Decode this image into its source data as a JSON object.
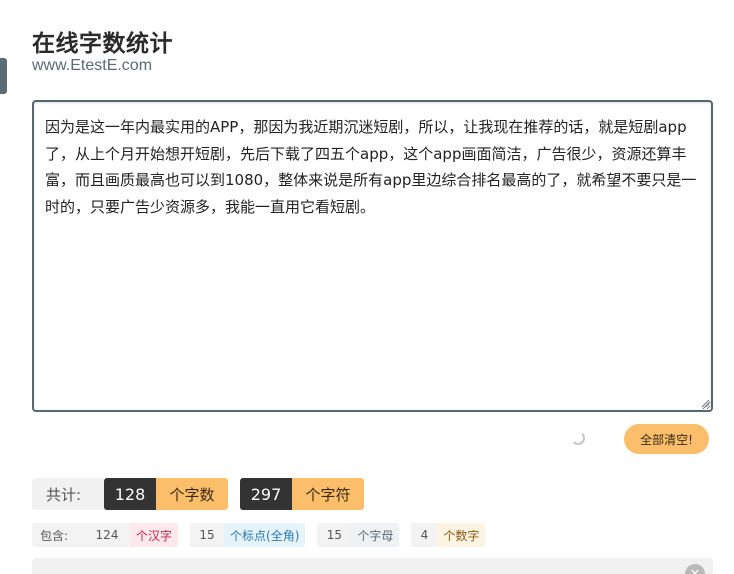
{
  "header": {
    "title": "在线字数统计",
    "site": "www.EtestE.com"
  },
  "editor": {
    "text": "因为是这一年内最实用的APP，那因为我近期沉迷短剧，所以，让我现在推荐的话，就是短剧app了，从上个月开始想开短剧，先后下载了四五个app，这个app画面简洁，广告很少，资源还算丰富，而且画质最高也可以到1080，整体来说是所有app里边综合排名最高的了，就希望不要只是一时的，只要广告少资源多，我能一直用它看短剧。"
  },
  "actions": {
    "clear_label": "全部清空!"
  },
  "stats": {
    "total_label": "共计:",
    "word_count": "128",
    "word_unit": "个字数",
    "char_count": "297",
    "char_unit": "个字符"
  },
  "breakdown": {
    "label": "包含:",
    "items": [
      {
        "value": "124",
        "unit": "个汉字"
      },
      {
        "value": "15",
        "unit": "个标点(全角)"
      },
      {
        "value": "15",
        "unit": "个字母"
      },
      {
        "value": "4",
        "unit": "个数字"
      }
    ]
  },
  "colors": {
    "accent": "#fbbf6c",
    "dark": "#333333",
    "hanzi_bg": "#fde8ec",
    "hanzi_fg": "#c7254e",
    "punct_bg": "#e6f3fb",
    "punct_fg": "#2a7ab0",
    "letter_bg": "#eef2f4",
    "letter_fg": "#5b6b73",
    "digit_bg": "#fdf3e3",
    "digit_fg": "#8a5a10"
  }
}
